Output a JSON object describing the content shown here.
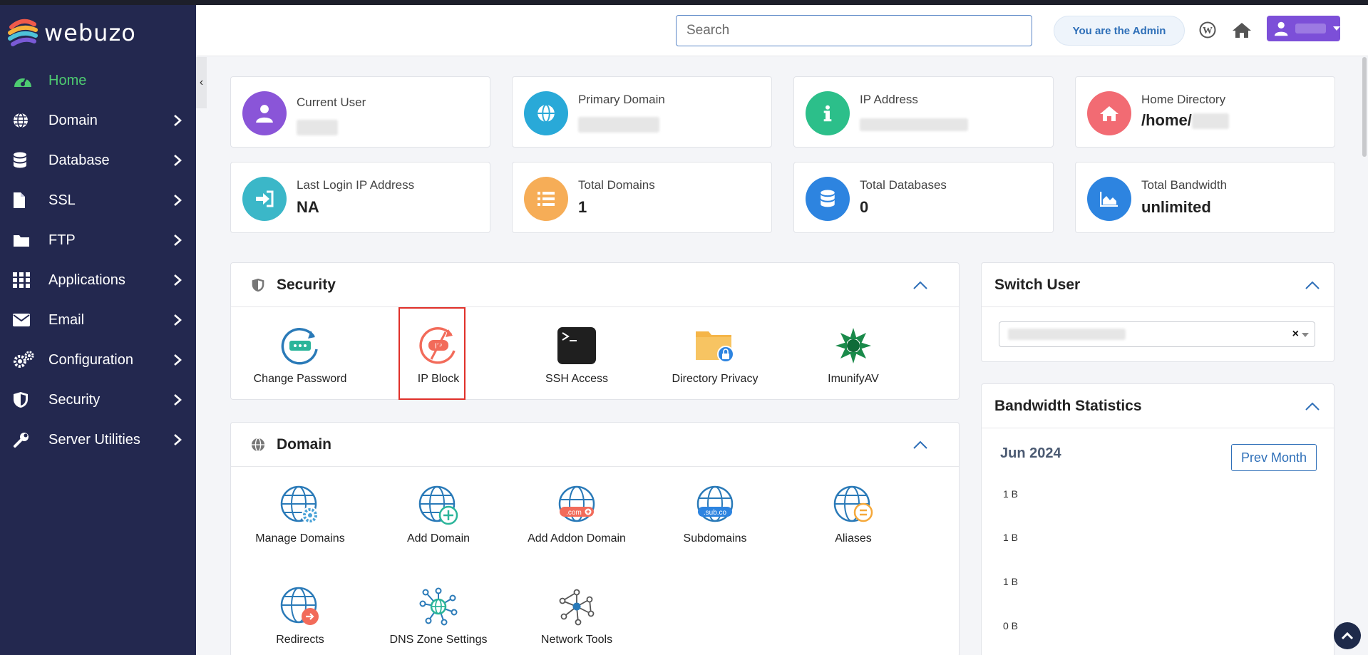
{
  "brand": {
    "name": "webuzo"
  },
  "sidebar": {
    "items": [
      {
        "label": "Home",
        "icon": "dashboard-icon",
        "active": true
      },
      {
        "label": "Domain",
        "icon": "globe-icon"
      },
      {
        "label": "Database",
        "icon": "database-icon"
      },
      {
        "label": "SSL",
        "icon": "file-icon"
      },
      {
        "label": "FTP",
        "icon": "folder-icon"
      },
      {
        "label": "Applications",
        "icon": "grid-icon"
      },
      {
        "label": "Email",
        "icon": "envelope-icon"
      },
      {
        "label": "Configuration",
        "icon": "gears-icon"
      },
      {
        "label": "Security",
        "icon": "shield-icon"
      },
      {
        "label": "Server Utilities",
        "icon": "wrench-icon"
      }
    ]
  },
  "header": {
    "search_placeholder": "Search",
    "admin_label": "You are the Admin"
  },
  "cards": [
    {
      "label": "Current User",
      "value": "",
      "color": "#8a55d8",
      "icon": "user-icon"
    },
    {
      "label": "Primary Domain",
      "value": "",
      "color": "#29a9d8",
      "icon": "globe-icon"
    },
    {
      "label": "IP Address",
      "value": "",
      "color": "#2cbf8a",
      "icon": "info-icon"
    },
    {
      "label": "Home Directory",
      "value": "/home/",
      "color": "#f26b73",
      "icon": "home-icon"
    },
    {
      "label": "Last Login IP Address",
      "value": "NA",
      "color": "#3bb7c8",
      "icon": "sign-in-icon"
    },
    {
      "label": "Total Domains",
      "value": "1",
      "color": "#f6ad57",
      "icon": "list-icon"
    },
    {
      "label": "Total Databases",
      "value": "0",
      "color": "#2d84e0",
      "icon": "database-icon"
    },
    {
      "label": "Total Bandwidth",
      "value": "unlimited",
      "color": "#2d84e0",
      "icon": "area-chart-icon"
    }
  ],
  "security_panel": {
    "title": "Security",
    "tiles": [
      {
        "label": "Change Password"
      },
      {
        "label": "IP Block",
        "highlighted": true
      },
      {
        "label": "SSH Access"
      },
      {
        "label": "Directory Privacy"
      },
      {
        "label": "ImunifyAV"
      }
    ]
  },
  "domain_panel": {
    "title": "Domain",
    "tiles": [
      {
        "label": "Manage Domains"
      },
      {
        "label": "Add Domain"
      },
      {
        "label": "Add Addon Domain"
      },
      {
        "label": "Subdomains"
      },
      {
        "label": "Aliases"
      },
      {
        "label": "Redirects"
      },
      {
        "label": "DNS Zone Settings"
      },
      {
        "label": "Network Tools"
      }
    ],
    "badges": {
      "com": ".com",
      "sub": ".sub.co",
      "ip": "IP"
    }
  },
  "switch_user": {
    "title": "Switch User",
    "clear": "×"
  },
  "bandwidth": {
    "title": "Bandwidth Statistics",
    "month": "Jun 2024",
    "prev_label": "Prev Month",
    "y_ticks": [
      "1 B",
      "1 B",
      "1 B",
      "0 B"
    ]
  },
  "colors": {
    "sidebar_bg": "#23284f",
    "active": "#4ecb71",
    "accent": "#2e6fb8",
    "highlight": "#e0302a"
  }
}
